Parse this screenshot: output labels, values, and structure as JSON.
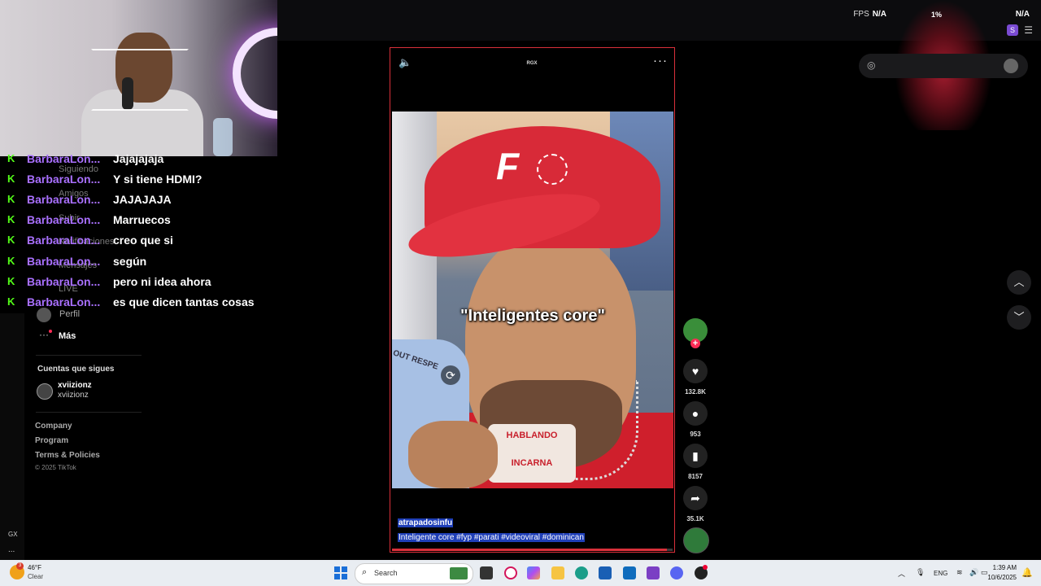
{
  "overlay": {
    "fps_label": "FPS",
    "fps_value": "N/A",
    "pct": "1%",
    "na_right": "N/A",
    "s_badge": "S"
  },
  "chat": {
    "messages": [
      {
        "user": "BarbaraLon...",
        "text": "Jajajajaja"
      },
      {
        "user": "BarbaraLon...",
        "text": "Y si tiene HDMI?"
      },
      {
        "user": "BarbaraLon...",
        "text": "JAJAJAJA"
      },
      {
        "user": "BarbaraLon...",
        "text": "Marruecos"
      },
      {
        "user": "BarbaraLon...",
        "text": "creo que si"
      },
      {
        "user": "BarbaraLon...",
        "text": "según"
      },
      {
        "user": "BarbaraLon...",
        "text": "pero ni idea ahora"
      },
      {
        "user": "BarbaraLon...",
        "text": "es que dicen tantas cosas"
      }
    ]
  },
  "sidebar": {
    "nav": [
      "Siguiendo",
      "Amigos",
      "Subir",
      "Notificaciones",
      "Mensajes",
      "LIVE"
    ],
    "profile": "Perfil",
    "more": "Más",
    "following_title": "Cuentas que sigues",
    "account_name": "xviizionz",
    "account_handle": "xviizionz",
    "footer": [
      "Company",
      "Program",
      "Terms & Policies"
    ],
    "copyright": "© 2025 TikTok",
    "gx": "GX",
    "dots": "..."
  },
  "video": {
    "badge": "RGX",
    "caption_overlay": "\"Inteligentes core\"",
    "shirt_text_1": "HABLANDO",
    "shirt_text_2": "INCARNA",
    "arm_text": "OUT RESPE",
    "author": "atrapadosinfu",
    "description": "Inteligente core #fyp  #parati  #videoviral  #dominican",
    "progress": 0.98
  },
  "actions": {
    "likes": "132.8K",
    "comments": "953",
    "saves": "8157",
    "shares": "35.1K"
  },
  "taskbar": {
    "temp": "46°F",
    "condition": "Clear",
    "weather_badge": "3",
    "search_placeholder": "Search",
    "lang": "ENG",
    "time": "1:39 AM",
    "date": "10/6/2025"
  },
  "colors": {
    "kick_green": "#53fc18",
    "username_purple": "#a970ff",
    "tiktok_red": "#fe2c55",
    "highlight_blue": "#1f3fb8"
  }
}
